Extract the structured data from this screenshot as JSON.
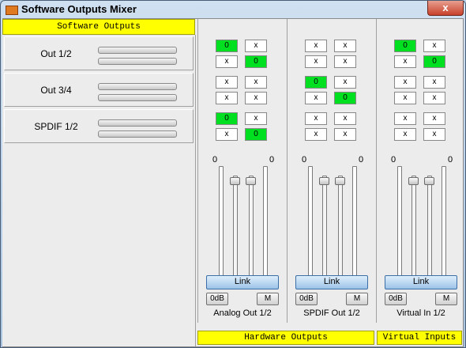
{
  "window": {
    "title": "Software Outputs Mixer",
    "close_glyph": "x"
  },
  "software_outputs": {
    "header": "Software Outputs",
    "rows": [
      {
        "label": "Out 1/2"
      },
      {
        "label": "Out 3/4"
      },
      {
        "label": "SPDIF 1/2"
      }
    ]
  },
  "strips": [
    {
      "name": "Analog Out 1/2",
      "matrix": [
        [
          "0",
          "x"
        ],
        [
          "x",
          "0"
        ],
        [
          "x",
          "x"
        ],
        [
          "x",
          "x"
        ],
        [
          "0",
          "x"
        ],
        [
          "x",
          "0"
        ]
      ],
      "level_left": "0",
      "level_right": "0",
      "link_label": "Link",
      "odb_label": "0dB",
      "mute_label": "M"
    },
    {
      "name": "SPDIF Out 1/2",
      "matrix": [
        [
          "x",
          "x"
        ],
        [
          "x",
          "x"
        ],
        [
          "0",
          "x"
        ],
        [
          "x",
          "0"
        ],
        [
          "x",
          "x"
        ],
        [
          "x",
          "x"
        ]
      ],
      "level_left": "0",
      "level_right": "0",
      "link_label": "Link",
      "odb_label": "0dB",
      "mute_label": "M"
    },
    {
      "name": "Virtual In 1/2",
      "matrix": [
        [
          "0",
          "x"
        ],
        [
          "x",
          "0"
        ],
        [
          "x",
          "x"
        ],
        [
          "x",
          "x"
        ],
        [
          "x",
          "x"
        ],
        [
          "x",
          "x"
        ]
      ],
      "level_left": "0",
      "level_right": "0",
      "link_label": "Link",
      "odb_label": "0dB",
      "mute_label": "M"
    }
  ],
  "hardware_outputs_header": "Hardware Outputs",
  "virtual_inputs_header": "Virtual Inputs",
  "colors": {
    "header_yellow": "#ffff00",
    "active_green": "#00e020",
    "link_blue": "#9cc3e8"
  }
}
